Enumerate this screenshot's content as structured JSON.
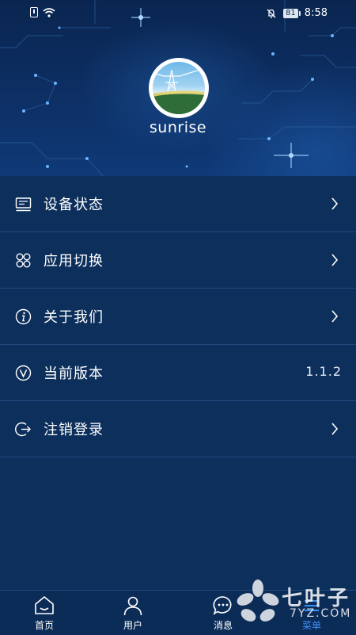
{
  "status_bar": {
    "battery": "81",
    "time": "8:58"
  },
  "profile": {
    "username": "sunrise"
  },
  "menu": {
    "items": [
      {
        "label": "设备状态",
        "icon": "monitor-icon"
      },
      {
        "label": "应用切换",
        "icon": "apps-icon"
      },
      {
        "label": "关于我们",
        "icon": "info-icon"
      },
      {
        "label": "当前版本",
        "icon": "version-icon",
        "value": "1.1.2"
      },
      {
        "label": "注销登录",
        "icon": "logout-icon"
      }
    ]
  },
  "bottom_nav": {
    "items": [
      {
        "label": "首页",
        "icon": "home-icon"
      },
      {
        "label": "用户",
        "icon": "user-icon"
      },
      {
        "label": "消息",
        "icon": "message-icon"
      },
      {
        "label": "菜单",
        "icon": "menu-icon",
        "active": true
      }
    ]
  },
  "watermark": {
    "brand_cn": "七叶子",
    "brand_en": "7YZ.COM"
  },
  "colors": {
    "background": "#0d2f5c",
    "divider": "#214a7e",
    "active": "#3c8ff5"
  }
}
